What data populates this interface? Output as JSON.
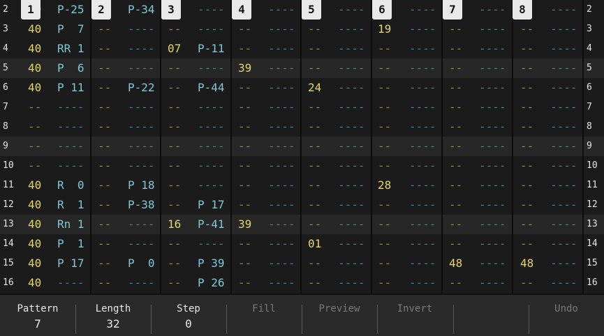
{
  "tracks": [
    "1",
    "2",
    "3",
    "4",
    "5",
    "6",
    "7",
    "8"
  ],
  "rows": [
    {
      "num": "2",
      "alt": false,
      "cells": [
        "40",
        "P-25",
        "--",
        "P-34",
        "--",
        "----",
        "--",
        "----",
        "--",
        "----",
        "--",
        "----",
        "--",
        "----",
        "--",
        "----"
      ]
    },
    {
      "num": "3",
      "alt": false,
      "cells": [
        "40",
        "P  7",
        "--",
        "----",
        "--",
        "----",
        "--",
        "----",
        "--",
        "----",
        "19",
        "----",
        "--",
        "----",
        "--",
        "----"
      ]
    },
    {
      "num": "4",
      "alt": false,
      "cells": [
        "40",
        "RR 1",
        "--",
        "----",
        "07",
        "P-11",
        "--",
        "----",
        "--",
        "----",
        "--",
        "----",
        "--",
        "----",
        "--",
        "----"
      ]
    },
    {
      "num": "5",
      "alt": true,
      "cells": [
        "40",
        "P  6",
        "--",
        "----",
        "--",
        "----",
        "39",
        "----",
        "--",
        "----",
        "--",
        "----",
        "--",
        "----",
        "--",
        "----"
      ]
    },
    {
      "num": "6",
      "alt": false,
      "cells": [
        "40",
        "P 11",
        "--",
        "P-22",
        "--",
        "P-44",
        "--",
        "----",
        "24",
        "----",
        "--",
        "----",
        "--",
        "----",
        "--",
        "----"
      ]
    },
    {
      "num": "7",
      "alt": false,
      "cells": [
        "--",
        "----",
        "--",
        "----",
        "--",
        "----",
        "--",
        "----",
        "--",
        "----",
        "--",
        "----",
        "--",
        "----",
        "--",
        "----"
      ]
    },
    {
      "num": "8",
      "alt": false,
      "cells": [
        "--",
        "----",
        "--",
        "----",
        "--",
        "----",
        "--",
        "----",
        "--",
        "----",
        "--",
        "----",
        "--",
        "----",
        "--",
        "----"
      ]
    },
    {
      "num": "9",
      "alt": true,
      "cells": [
        "--",
        "----",
        "--",
        "----",
        "--",
        "----",
        "--",
        "----",
        "--",
        "----",
        "--",
        "----",
        "--",
        "----",
        "--",
        "----"
      ]
    },
    {
      "num": "10",
      "alt": false,
      "cells": [
        "--",
        "----",
        "--",
        "----",
        "--",
        "----",
        "--",
        "----",
        "--",
        "----",
        "--",
        "----",
        "--",
        "----",
        "--",
        "----"
      ]
    },
    {
      "num": "11",
      "alt": false,
      "cells": [
        "40",
        "R  0",
        "--",
        "P 18",
        "--",
        "----",
        "--",
        "----",
        "--",
        "----",
        "28",
        "----",
        "--",
        "----",
        "--",
        "----"
      ]
    },
    {
      "num": "12",
      "alt": false,
      "cells": [
        "40",
        "R  1",
        "--",
        "P-38",
        "--",
        "P 17",
        "--",
        "----",
        "--",
        "----",
        "--",
        "----",
        "--",
        "----",
        "--",
        "----"
      ]
    },
    {
      "num": "13",
      "alt": true,
      "cells": [
        "40",
        "Rn 1",
        "--",
        "----",
        "16",
        "P-41",
        "39",
        "----",
        "--",
        "----",
        "--",
        "----",
        "--",
        "----",
        "--",
        "----"
      ]
    },
    {
      "num": "14",
      "alt": false,
      "cells": [
        "40",
        "P  1",
        "--",
        "----",
        "--",
        "----",
        "--",
        "----",
        "01",
        "----",
        "--",
        "----",
        "--",
        "----",
        "--",
        "----"
      ]
    },
    {
      "num": "15",
      "alt": false,
      "cells": [
        "40",
        "P 17",
        "--",
        "P  0",
        "--",
        "P 39",
        "--",
        "----",
        "--",
        "----",
        "--",
        "----",
        "48",
        "----",
        "48",
        "----"
      ]
    },
    {
      "num": "16",
      "alt": false,
      "cells": [
        "40",
        "----",
        "--",
        "----",
        "--",
        "P 26",
        "--",
        "----",
        "--",
        "----",
        "--",
        "----",
        "--",
        "----",
        "--",
        "----"
      ]
    }
  ],
  "footer": {
    "pattern_label": "Pattern",
    "pattern_value": "7",
    "length_label": "Length",
    "length_value": "32",
    "step_label": "Step",
    "step_value": "0",
    "fill_label": "Fill",
    "preview_label": "Preview",
    "invert_label": "Invert",
    "blank_label": "",
    "undo_label": "Undo"
  },
  "colors": {
    "velocity": "#e6d66a",
    "note": "#7ec8d8",
    "track_header_bg": "#e9e9e9",
    "alt_row_bg": "#272727"
  }
}
